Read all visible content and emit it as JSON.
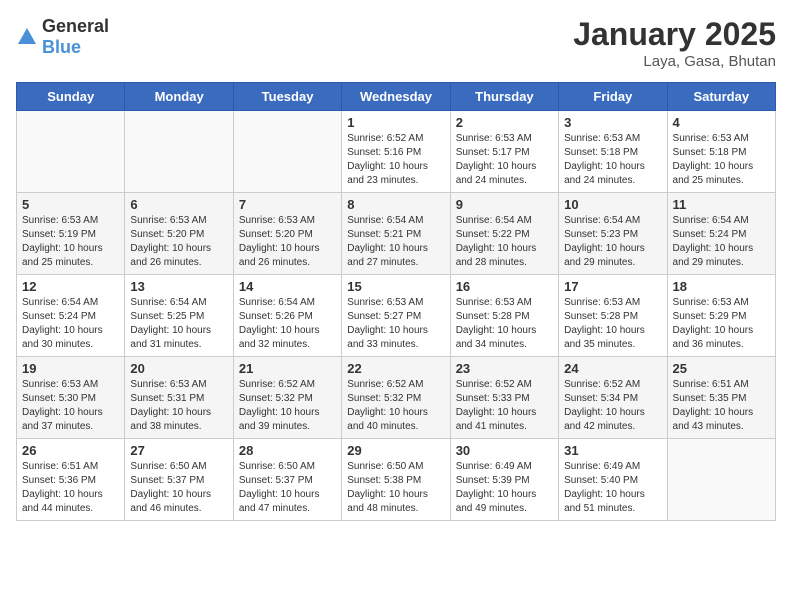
{
  "header": {
    "logo_general": "General",
    "logo_blue": "Blue",
    "month_title": "January 2025",
    "location": "Laya, Gasa, Bhutan"
  },
  "weekdays": [
    "Sunday",
    "Monday",
    "Tuesday",
    "Wednesday",
    "Thursday",
    "Friday",
    "Saturday"
  ],
  "weeks": [
    [
      {
        "day": "",
        "info": ""
      },
      {
        "day": "",
        "info": ""
      },
      {
        "day": "",
        "info": ""
      },
      {
        "day": "1",
        "info": "Sunrise: 6:52 AM\nSunset: 5:16 PM\nDaylight: 10 hours\nand 23 minutes."
      },
      {
        "day": "2",
        "info": "Sunrise: 6:53 AM\nSunset: 5:17 PM\nDaylight: 10 hours\nand 24 minutes."
      },
      {
        "day": "3",
        "info": "Sunrise: 6:53 AM\nSunset: 5:18 PM\nDaylight: 10 hours\nand 24 minutes."
      },
      {
        "day": "4",
        "info": "Sunrise: 6:53 AM\nSunset: 5:18 PM\nDaylight: 10 hours\nand 25 minutes."
      }
    ],
    [
      {
        "day": "5",
        "info": "Sunrise: 6:53 AM\nSunset: 5:19 PM\nDaylight: 10 hours\nand 25 minutes."
      },
      {
        "day": "6",
        "info": "Sunrise: 6:53 AM\nSunset: 5:20 PM\nDaylight: 10 hours\nand 26 minutes."
      },
      {
        "day": "7",
        "info": "Sunrise: 6:53 AM\nSunset: 5:20 PM\nDaylight: 10 hours\nand 26 minutes."
      },
      {
        "day": "8",
        "info": "Sunrise: 6:54 AM\nSunset: 5:21 PM\nDaylight: 10 hours\nand 27 minutes."
      },
      {
        "day": "9",
        "info": "Sunrise: 6:54 AM\nSunset: 5:22 PM\nDaylight: 10 hours\nand 28 minutes."
      },
      {
        "day": "10",
        "info": "Sunrise: 6:54 AM\nSunset: 5:23 PM\nDaylight: 10 hours\nand 29 minutes."
      },
      {
        "day": "11",
        "info": "Sunrise: 6:54 AM\nSunset: 5:24 PM\nDaylight: 10 hours\nand 29 minutes."
      }
    ],
    [
      {
        "day": "12",
        "info": "Sunrise: 6:54 AM\nSunset: 5:24 PM\nDaylight: 10 hours\nand 30 minutes."
      },
      {
        "day": "13",
        "info": "Sunrise: 6:54 AM\nSunset: 5:25 PM\nDaylight: 10 hours\nand 31 minutes."
      },
      {
        "day": "14",
        "info": "Sunrise: 6:54 AM\nSunset: 5:26 PM\nDaylight: 10 hours\nand 32 minutes."
      },
      {
        "day": "15",
        "info": "Sunrise: 6:53 AM\nSunset: 5:27 PM\nDaylight: 10 hours\nand 33 minutes."
      },
      {
        "day": "16",
        "info": "Sunrise: 6:53 AM\nSunset: 5:28 PM\nDaylight: 10 hours\nand 34 minutes."
      },
      {
        "day": "17",
        "info": "Sunrise: 6:53 AM\nSunset: 5:28 PM\nDaylight: 10 hours\nand 35 minutes."
      },
      {
        "day": "18",
        "info": "Sunrise: 6:53 AM\nSunset: 5:29 PM\nDaylight: 10 hours\nand 36 minutes."
      }
    ],
    [
      {
        "day": "19",
        "info": "Sunrise: 6:53 AM\nSunset: 5:30 PM\nDaylight: 10 hours\nand 37 minutes."
      },
      {
        "day": "20",
        "info": "Sunrise: 6:53 AM\nSunset: 5:31 PM\nDaylight: 10 hours\nand 38 minutes."
      },
      {
        "day": "21",
        "info": "Sunrise: 6:52 AM\nSunset: 5:32 PM\nDaylight: 10 hours\nand 39 minutes."
      },
      {
        "day": "22",
        "info": "Sunrise: 6:52 AM\nSunset: 5:32 PM\nDaylight: 10 hours\nand 40 minutes."
      },
      {
        "day": "23",
        "info": "Sunrise: 6:52 AM\nSunset: 5:33 PM\nDaylight: 10 hours\nand 41 minutes."
      },
      {
        "day": "24",
        "info": "Sunrise: 6:52 AM\nSunset: 5:34 PM\nDaylight: 10 hours\nand 42 minutes."
      },
      {
        "day": "25",
        "info": "Sunrise: 6:51 AM\nSunset: 5:35 PM\nDaylight: 10 hours\nand 43 minutes."
      }
    ],
    [
      {
        "day": "26",
        "info": "Sunrise: 6:51 AM\nSunset: 5:36 PM\nDaylight: 10 hours\nand 44 minutes."
      },
      {
        "day": "27",
        "info": "Sunrise: 6:50 AM\nSunset: 5:37 PM\nDaylight: 10 hours\nand 46 minutes."
      },
      {
        "day": "28",
        "info": "Sunrise: 6:50 AM\nSunset: 5:37 PM\nDaylight: 10 hours\nand 47 minutes."
      },
      {
        "day": "29",
        "info": "Sunrise: 6:50 AM\nSunset: 5:38 PM\nDaylight: 10 hours\nand 48 minutes."
      },
      {
        "day": "30",
        "info": "Sunrise: 6:49 AM\nSunset: 5:39 PM\nDaylight: 10 hours\nand 49 minutes."
      },
      {
        "day": "31",
        "info": "Sunrise: 6:49 AM\nSunset: 5:40 PM\nDaylight: 10 hours\nand 51 minutes."
      },
      {
        "day": "",
        "info": ""
      }
    ]
  ]
}
